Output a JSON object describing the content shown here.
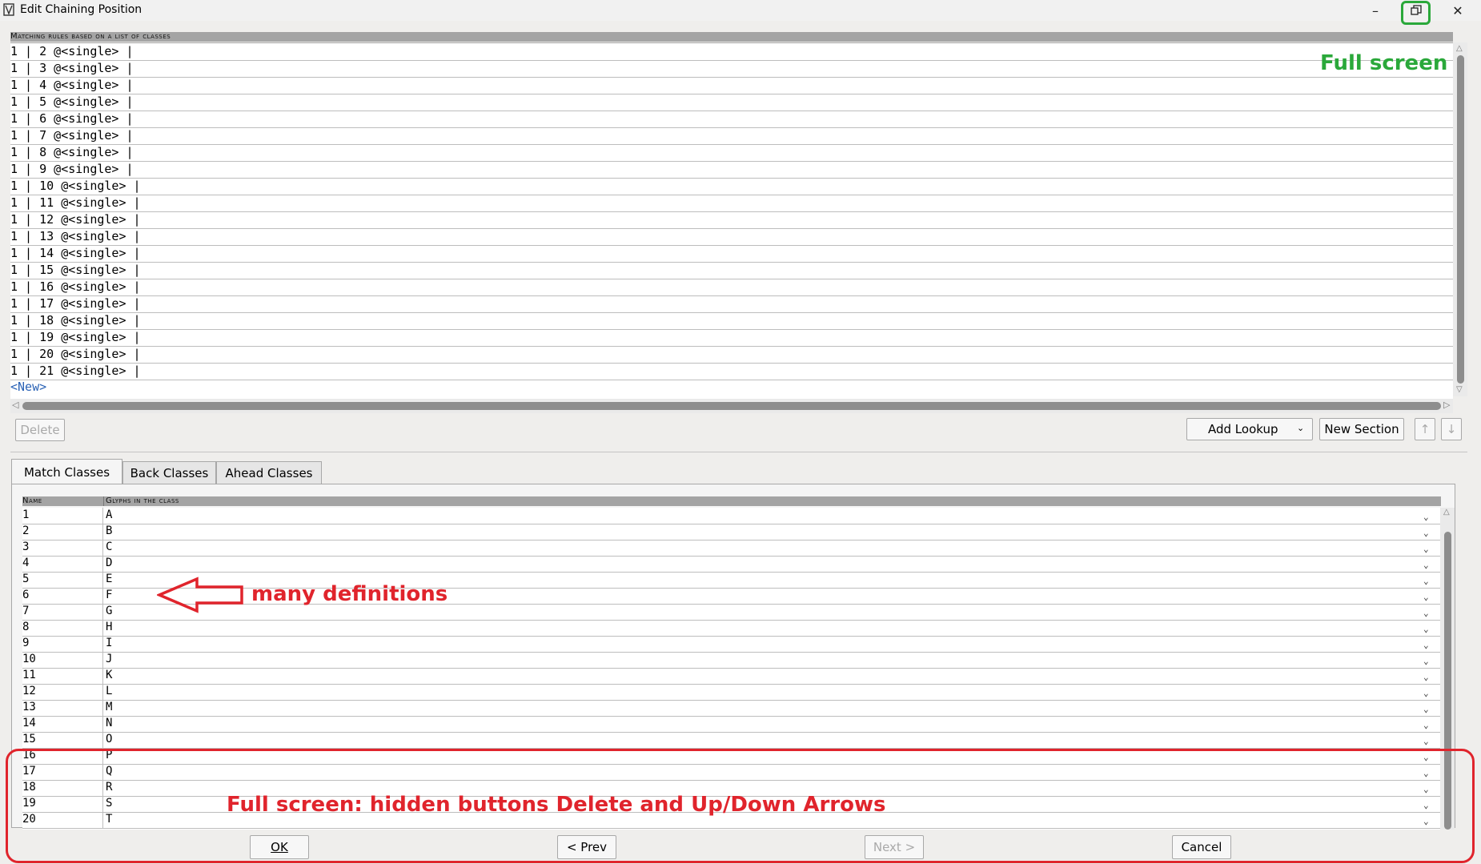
{
  "window": {
    "title": "Edit Chaining Position",
    "minimize_icon": "minimize-icon",
    "restore_icon": "restore-icon",
    "close_icon": "close-icon"
  },
  "rules": {
    "header": "Matching rules based on a list of classes",
    "rows": [
      "1 | 2 @<single> |",
      "1 | 3 @<single> |",
      "1 | 4 @<single> |",
      "1 | 5 @<single> |",
      "1 | 6 @<single> |",
      "1 | 7 @<single> |",
      "1 | 8 @<single> |",
      "1 | 9 @<single> |",
      "1 | 10 @<single> |",
      "1 | 11 @<single> |",
      "1 | 12 @<single> |",
      "1 | 13 @<single> |",
      "1 | 14 @<single> |",
      "1 | 15 @<single> |",
      "1 | 16 @<single> |",
      "1 | 17 @<single> |",
      "1 | 18 @<single> |",
      "1 | 19 @<single> |",
      "1 | 20 @<single> |",
      "1 | 21 @<single> |"
    ],
    "new_label": "<New>"
  },
  "toolbar": {
    "delete": "Delete",
    "add_lookup": "Add Lookup",
    "new_section": "New Section",
    "up_arrow": "↑",
    "down_arrow": "↓"
  },
  "tabs": [
    "Match Classes",
    "Back Classes",
    "Ahead Classes"
  ],
  "classes": {
    "col_name": "Name",
    "col_glyphs": "Glyphs in the class",
    "rows": [
      {
        "name": "1",
        "glyphs": "A"
      },
      {
        "name": "2",
        "glyphs": "B"
      },
      {
        "name": "3",
        "glyphs": "C"
      },
      {
        "name": "4",
        "glyphs": "D"
      },
      {
        "name": "5",
        "glyphs": "E"
      },
      {
        "name": "6",
        "glyphs": "F"
      },
      {
        "name": "7",
        "glyphs": "G"
      },
      {
        "name": "8",
        "glyphs": "H"
      },
      {
        "name": "9",
        "glyphs": "I"
      },
      {
        "name": "10",
        "glyphs": "J"
      },
      {
        "name": "11",
        "glyphs": "K"
      },
      {
        "name": "12",
        "glyphs": "L"
      },
      {
        "name": "13",
        "glyphs": "M"
      },
      {
        "name": "14",
        "glyphs": "N"
      },
      {
        "name": "15",
        "glyphs": "O"
      },
      {
        "name": "16",
        "glyphs": "P"
      },
      {
        "name": "17",
        "glyphs": "Q"
      },
      {
        "name": "18",
        "glyphs": "R"
      },
      {
        "name": "19",
        "glyphs": "S"
      },
      {
        "name": "20",
        "glyphs": "T"
      }
    ]
  },
  "footer": {
    "ok": "OK",
    "prev": "< Prev",
    "next": "Next >",
    "cancel": "Cancel"
  },
  "annotations": {
    "full_screen": "Full screen",
    "many_definitions": "many definitions",
    "hidden_buttons": "Full screen: hidden buttons Delete and Up/Down Arrows"
  },
  "colors": {
    "green_annotation": "#2aa83a",
    "red_annotation": "#e0242c",
    "new_link": "#2a62b5"
  }
}
